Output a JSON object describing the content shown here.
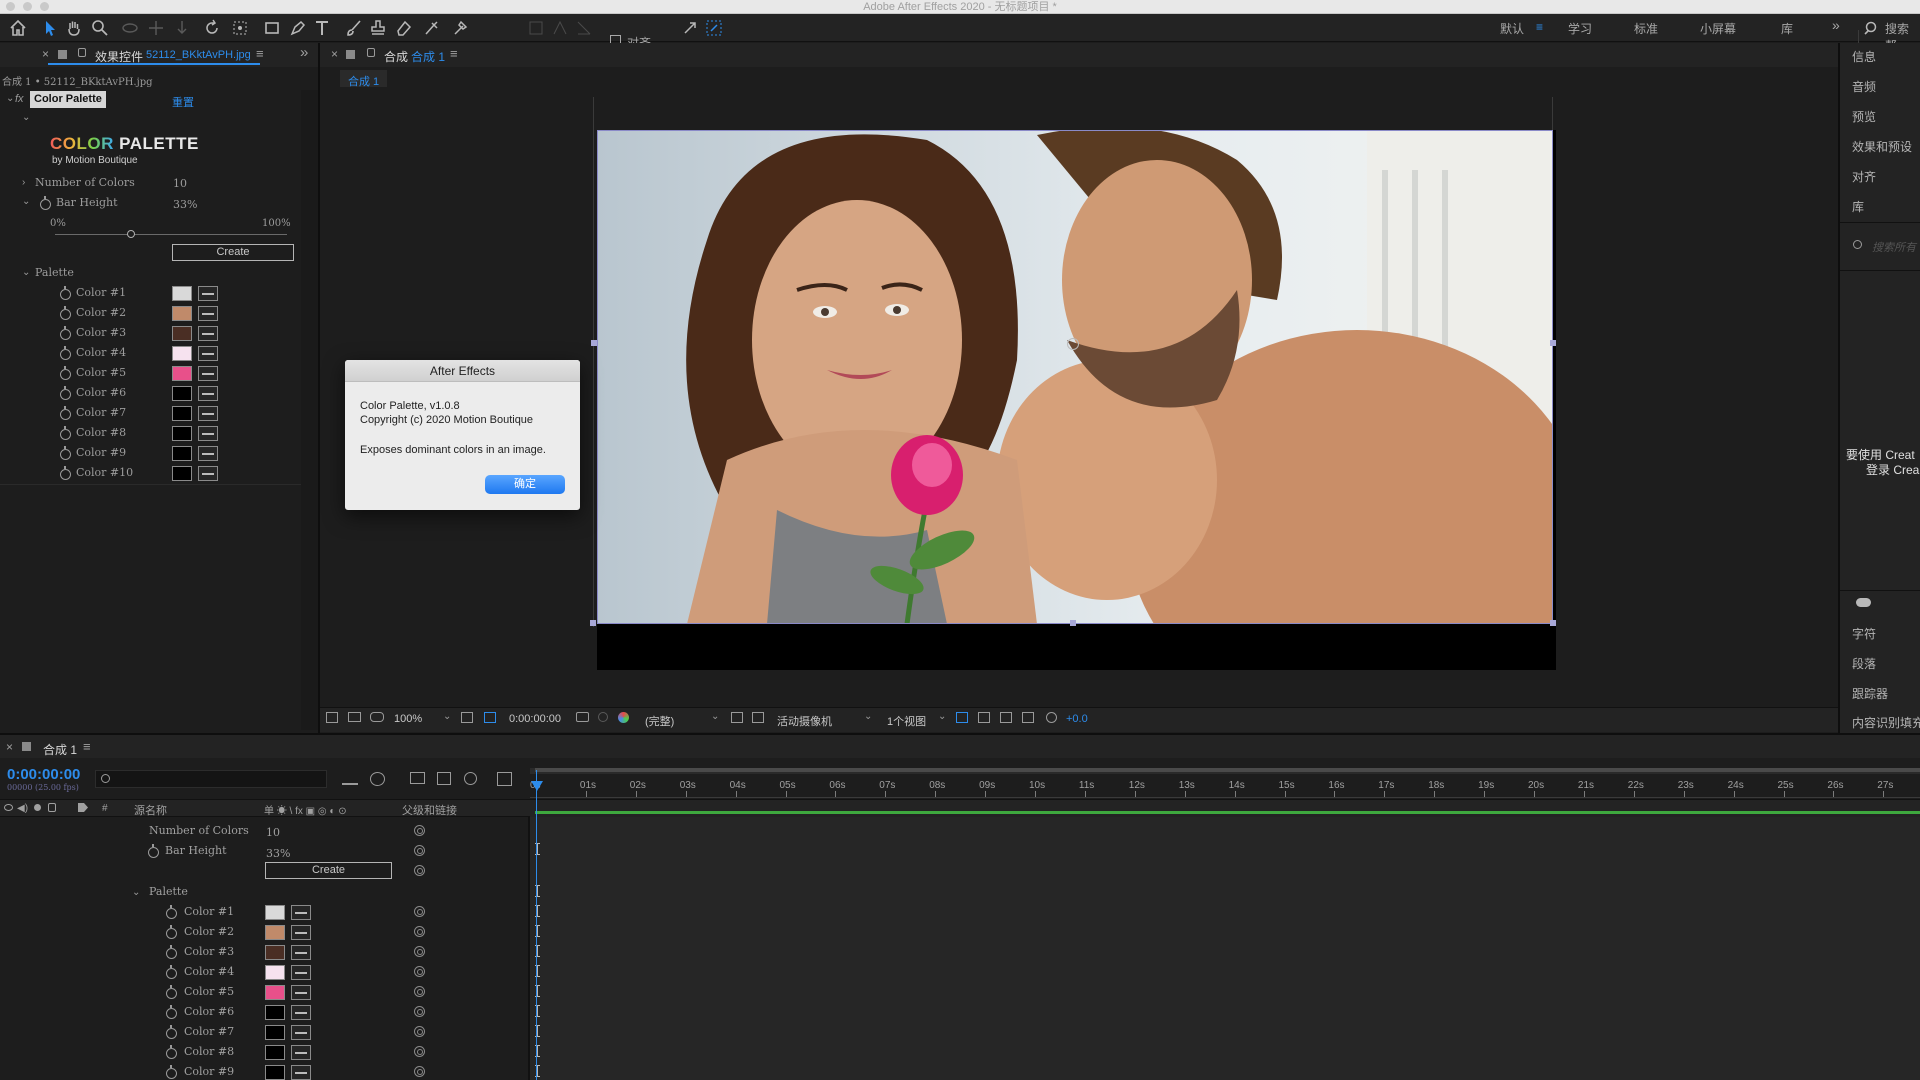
{
  "app": {
    "window_title": "Adobe After Effects 2020 - 无标题项目 *"
  },
  "toolbar": {
    "align_label": "对齐",
    "workspaces": [
      "默认",
      "学习",
      "标准",
      "小屏幕",
      "库"
    ],
    "more": "»",
    "search_label": "搜索帮"
  },
  "effect_controls": {
    "tab_label": "效果控件",
    "tab_file": "52112_BKktAvPH.jpg",
    "breadcrumb": "合成 1 • 52112_BKktAvPH.jpg",
    "effect_name": "Color Palette",
    "reset_label": "重置",
    "logo": {
      "word1": "COLOR",
      "word2": "PALETTE",
      "byline": "by Motion Boutique"
    },
    "number_of_colors_label": "Number of Colors",
    "number_of_colors_value": "10",
    "bar_height_label": "Bar Height",
    "bar_height_value": "33%",
    "slider_min": "0%",
    "slider_max": "100%",
    "slider_value": 0.33,
    "create_label": "Create",
    "palette_label": "Palette",
    "colors": [
      {
        "label": "Color #1",
        "hex": "#d9d9d9"
      },
      {
        "label": "Color #2",
        "hex": "#c08a6a"
      },
      {
        "label": "Color #3",
        "hex": "#4a2e24"
      },
      {
        "label": "Color #4",
        "hex": "#f6e2ef"
      },
      {
        "label": "Color #5",
        "hex": "#e8508a"
      },
      {
        "label": "Color #6",
        "hex": "#000000"
      },
      {
        "label": "Color #7",
        "hex": "#000000"
      },
      {
        "label": "Color #8",
        "hex": "#000000"
      },
      {
        "label": "Color #9",
        "hex": "#000000"
      },
      {
        "label": "Color #10",
        "hex": "#000000"
      }
    ]
  },
  "composition": {
    "tab_prefix": "合成",
    "tab_name": "合成 1",
    "flow_tab": "合成 1"
  },
  "dialog": {
    "title": "After Effects",
    "line1": "Color Palette, v1.0.8",
    "line2": "Copyright (c) 2020 Motion Boutique",
    "line3": "Exposes dominant colors in an image.",
    "ok_label": "确定"
  },
  "viewer_bar": {
    "zoom": "100%",
    "timecode": "0:00:00:00",
    "resolution": "(完整)",
    "camera": "活动摄像机",
    "views": "1个视图",
    "exposure": "+0.0"
  },
  "right_panel": {
    "items": [
      "信息",
      "音频",
      "预览",
      "效果和预设",
      "对齐",
      "库"
    ],
    "search_placeholder": "搜索所有",
    "cc_line1": "要使用 Creat",
    "cc_line2": "登录 Crea",
    "bottom_items": [
      "字符",
      "段落",
      "跟踪器",
      "内容识别填充"
    ]
  },
  "timeline": {
    "tab_label": "合成 1",
    "timecode": "0:00:00:00",
    "fps": "00000 (25.00 fps)",
    "col_source": "源名称",
    "col_parent": "父级和链接",
    "switch_icons": "单 ☀ \\ fx ▣ ◎ ◐ ⊙",
    "number_of_colors_label": "Number of Colors",
    "number_of_colors_value": "10",
    "bar_height_label": "Bar Height",
    "bar_height_value": "33%",
    "create_label": "Create",
    "palette_label": "Palette",
    "ruler": [
      "0s",
      "01s",
      "02s",
      "03s",
      "04s",
      "05s",
      "06s",
      "07s",
      "08s",
      "09s",
      "10s",
      "11s",
      "12s",
      "13s",
      "14s",
      "15s",
      "16s",
      "17s",
      "18s",
      "19s",
      "20s",
      "21s",
      "22s",
      "23s",
      "24s",
      "25s",
      "26s",
      "27s"
    ]
  }
}
